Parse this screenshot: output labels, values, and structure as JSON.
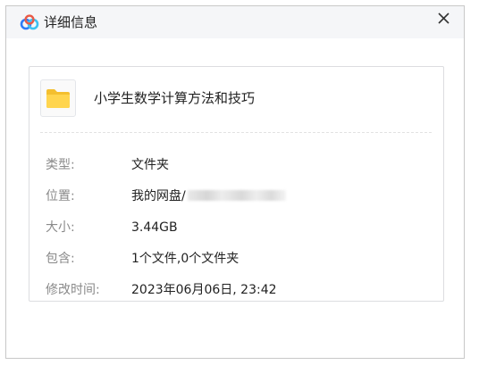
{
  "window": {
    "title": "详细信息",
    "logo_icon": "baidu-netdisk-logo",
    "close_icon": "close-icon"
  },
  "file": {
    "icon": "folder-icon",
    "icon_color": "#ffd34f",
    "name": "小学生数学计算方法和技巧"
  },
  "details": [
    {
      "label": "类型:",
      "value": "文件夹"
    },
    {
      "label": "位置:",
      "value": "我的网盘/"
    },
    {
      "label": "大小:",
      "value": "3.44GB"
    },
    {
      "label": "包含:",
      "value": "1个文件,0个文件夹"
    },
    {
      "label": "修改时间:",
      "value": "2023年06月06日, 23:42"
    }
  ]
}
